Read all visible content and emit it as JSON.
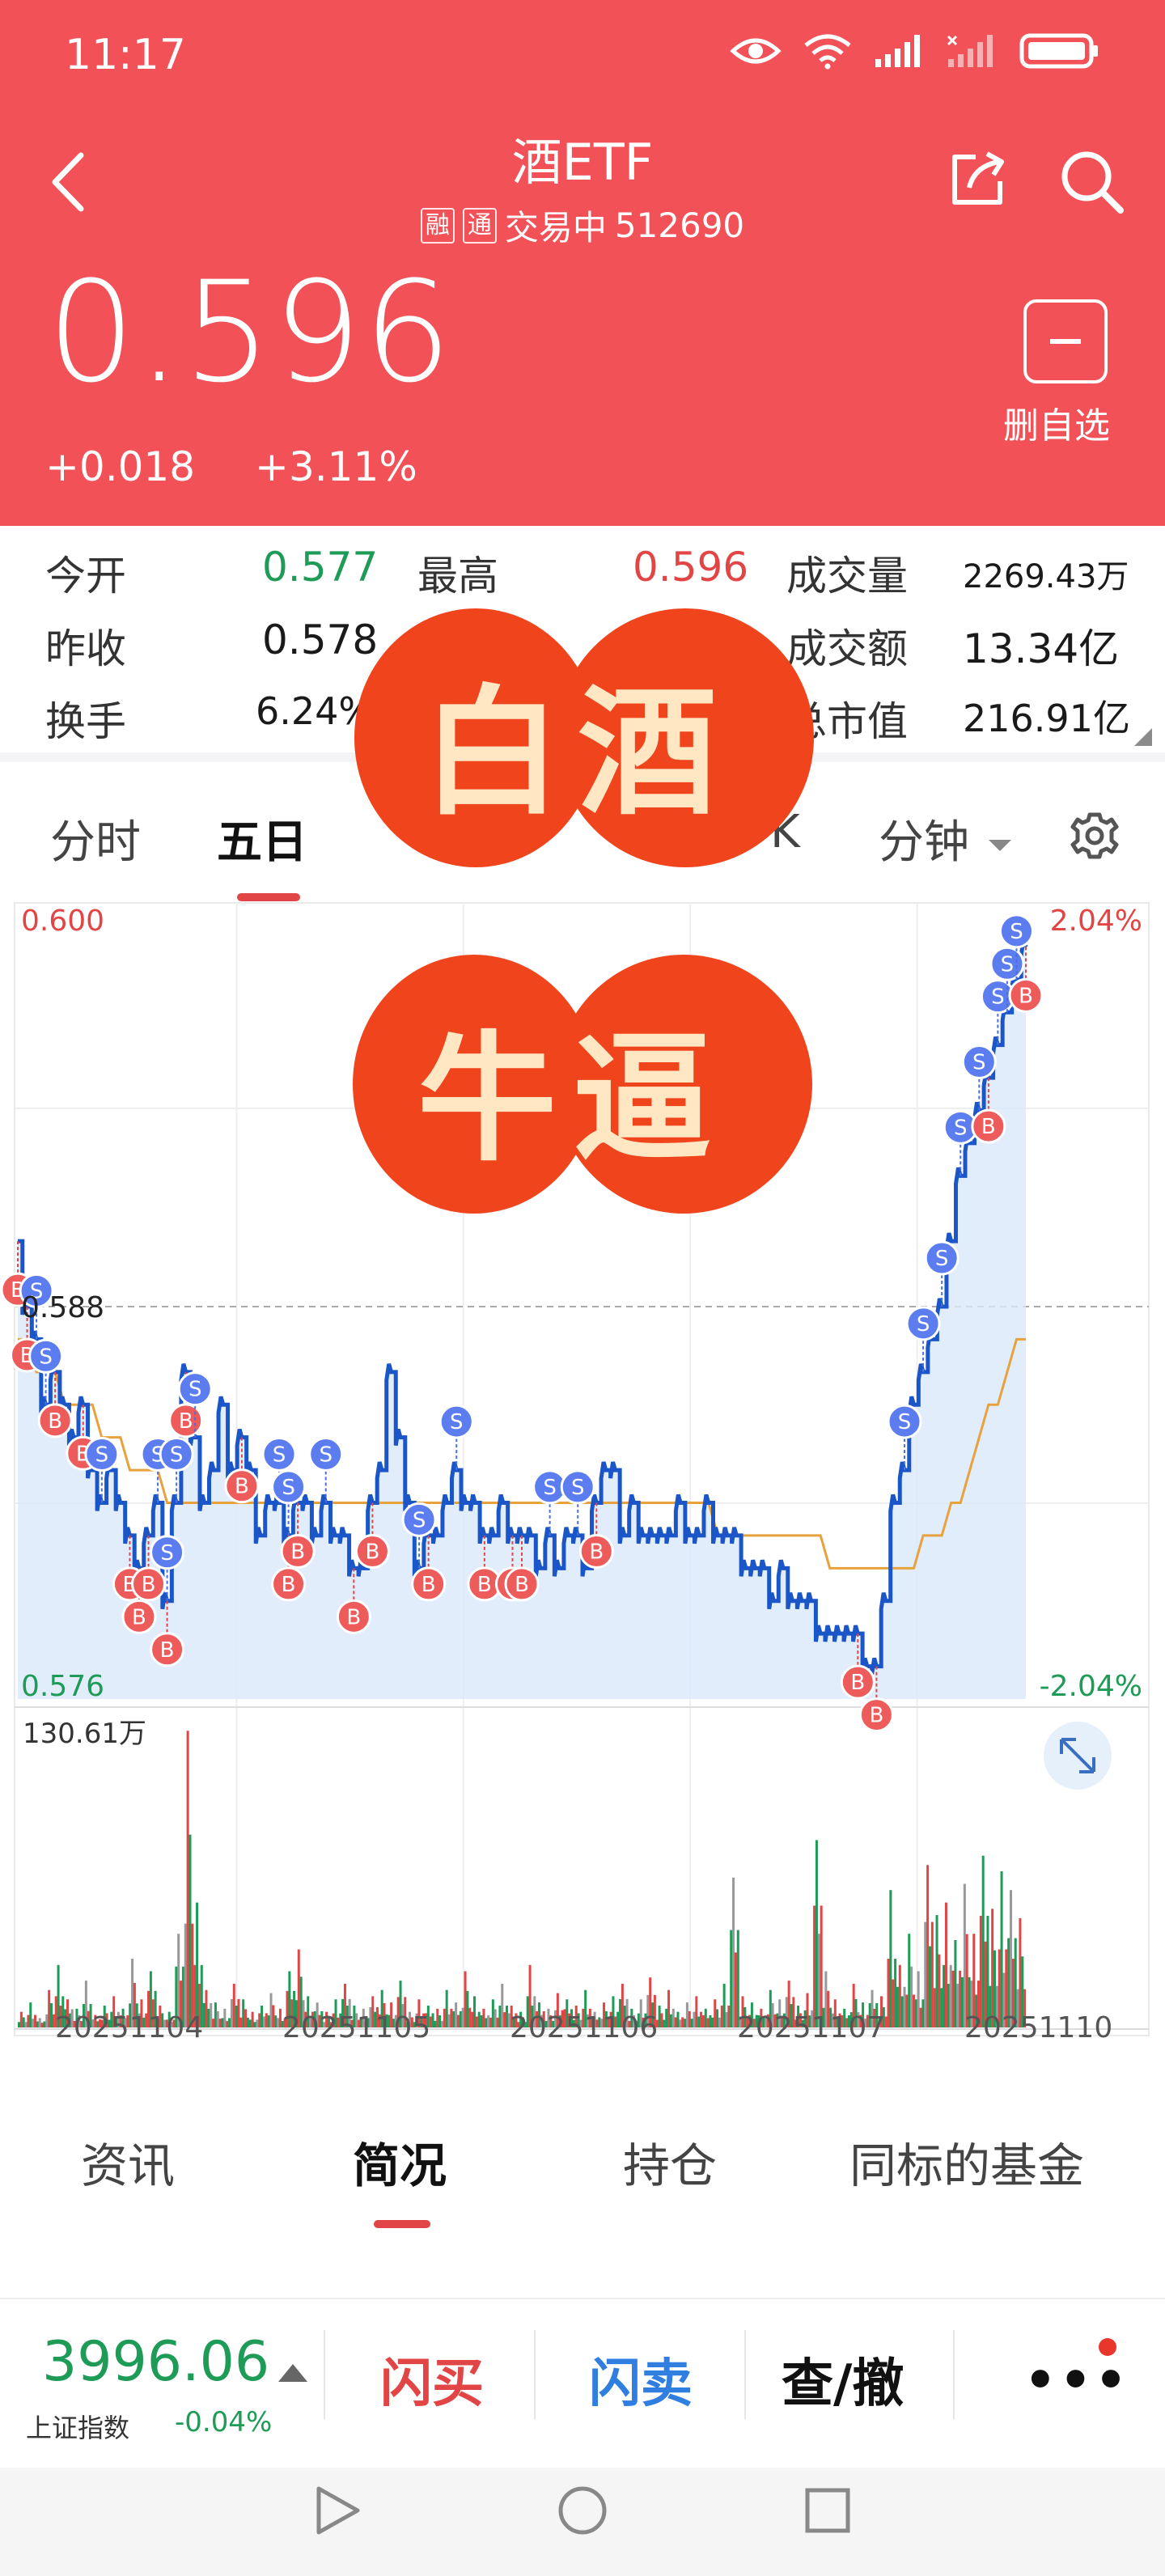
{
  "status": {
    "time": "11:17"
  },
  "header": {
    "title": "酒ETF",
    "tag1": "融",
    "tag2": "通",
    "trading_status": "交易中",
    "code": "512690",
    "price": "0.596",
    "change": "+0.018",
    "change_pct": "+3.11%",
    "remove_watch_label": "删自选",
    "bg_color": "#f25157"
  },
  "stats": {
    "open_label": "今开",
    "open_value": "0.577",
    "high_label": "最高",
    "high_value": "0.596",
    "volume_label": "成交量",
    "volume_value": "2269.43万",
    "prev_close_label": "昨收",
    "prev_close_value": "0.578",
    "amount_label": "成交额",
    "amount_value": "13.34亿",
    "turnover_label": "换手",
    "turnover_value": "6.24%",
    "mktcap_label": "总市值",
    "mktcap_value": "216.91亿"
  },
  "chart_tabs": {
    "intraday": "分时",
    "five_day": "五日",
    "k_partial": "K",
    "minute": "分钟"
  },
  "overlay": {
    "text1": "白酒",
    "text2": "牛逼"
  },
  "chart_data": {
    "type": "line",
    "price_axis": {
      "top": "0.600",
      "mid": "0.588",
      "bottom": "0.576"
    },
    "pct_axis": {
      "top": "2.04%",
      "bottom": "-2.04%"
    },
    "volume_max_label": "130.61万",
    "dates": [
      "20251104",
      "20251105",
      "20251106",
      "20251107",
      "20251110"
    ],
    "ylim": [
      0.576,
      0.6
    ],
    "reference": 0.588,
    "price_series": [
      0.59,
      0.588,
      0.587,
      0.585,
      0.586,
      0.585,
      0.584,
      0.585,
      0.583,
      0.582,
      0.583,
      0.582,
      0.581,
      0.58,
      0.581,
      0.582,
      0.579,
      0.582,
      0.586,
      0.584,
      0.582,
      0.583,
      0.585,
      0.583,
      0.584,
      0.583,
      0.581,
      0.582,
      0.582,
      0.581,
      0.582,
      0.582,
      0.581,
      0.582,
      0.581,
      0.581,
      0.58,
      0.58,
      0.582,
      0.583,
      0.586,
      0.584,
      0.582,
      0.58,
      0.581,
      0.581,
      0.582,
      0.583,
      0.582,
      0.582,
      0.581,
      0.581,
      0.582,
      0.581,
      0.581,
      0.581,
      0.58,
      0.581,
      0.58,
      0.581,
      0.581,
      0.58,
      0.582,
      0.583,
      0.583,
      0.581,
      0.582,
      0.581,
      0.581,
      0.581,
      0.581,
      0.582,
      0.581,
      0.581,
      0.582,
      0.581,
      0.581,
      0.581,
      0.58,
      0.58,
      0.58,
      0.579,
      0.58,
      0.579,
      0.579,
      0.579,
      0.578,
      0.578,
      0.578,
      0.578,
      0.578,
      0.577,
      0.577,
      0.579,
      0.582,
      0.583,
      0.585,
      0.586,
      0.587,
      0.588,
      0.59,
      0.592,
      0.593,
      0.594,
      0.595,
      0.596,
      0.597,
      0.598,
      0.599
    ],
    "avg_series": [
      0.587,
      0.587,
      0.586,
      0.586,
      0.586,
      0.585,
      0.585,
      0.585,
      0.585,
      0.584,
      0.584,
      0.584,
      0.583,
      0.583,
      0.583,
      0.583,
      0.582,
      0.582,
      0.582,
      0.582,
      0.582,
      0.582,
      0.582,
      0.582,
      0.582,
      0.582,
      0.582,
      0.582,
      0.582,
      0.582,
      0.582,
      0.582,
      0.582,
      0.582,
      0.582,
      0.582,
      0.582,
      0.582,
      0.582,
      0.582,
      0.582,
      0.582,
      0.582,
      0.582,
      0.582,
      0.582,
      0.582,
      0.582,
      0.582,
      0.582,
      0.582,
      0.582,
      0.582,
      0.582,
      0.582,
      0.582,
      0.582,
      0.582,
      0.582,
      0.582,
      0.582,
      0.582,
      0.582,
      0.582,
      0.582,
      0.582,
      0.582,
      0.582,
      0.582,
      0.582,
      0.582,
      0.582,
      0.582,
      0.582,
      0.582,
      0.581,
      0.581,
      0.581,
      0.581,
      0.581,
      0.581,
      0.581,
      0.581,
      0.581,
      0.581,
      0.581,
      0.581,
      0.58,
      0.58,
      0.58,
      0.58,
      0.58,
      0.58,
      0.58,
      0.58,
      0.58,
      0.58,
      0.581,
      0.581,
      0.581,
      0.582,
      0.582,
      0.583,
      0.584,
      0.585,
      0.585,
      0.586,
      0.587,
      0.587
    ],
    "markers": [
      {
        "t": "B",
        "i": 0
      },
      {
        "t": "B",
        "i": 1
      },
      {
        "t": "S",
        "i": 2
      },
      {
        "t": "S",
        "i": 3
      },
      {
        "t": "B",
        "i": 4
      },
      {
        "t": "B",
        "i": 7
      },
      {
        "t": "S",
        "i": 9
      },
      {
        "t": "B",
        "i": 12
      },
      {
        "t": "B",
        "i": 13
      },
      {
        "t": "B",
        "i": 14
      },
      {
        "t": "S",
        "i": 15
      },
      {
        "t": "S",
        "i": 16
      },
      {
        "t": "B",
        "i": 16
      },
      {
        "t": "S",
        "i": 17
      },
      {
        "t": "B",
        "i": 18
      },
      {
        "t": "S",
        "i": 19
      },
      {
        "t": "B",
        "i": 24
      },
      {
        "t": "S",
        "i": 28
      },
      {
        "t": "S",
        "i": 29
      },
      {
        "t": "B",
        "i": 29
      },
      {
        "t": "B",
        "i": 30
      },
      {
        "t": "S",
        "i": 33
      },
      {
        "t": "B",
        "i": 36
      },
      {
        "t": "B",
        "i": 38
      },
      {
        "t": "S",
        "i": 43
      },
      {
        "t": "B",
        "i": 44
      },
      {
        "t": "S",
        "i": 47
      },
      {
        "t": "B",
        "i": 50
      },
      {
        "t": "B",
        "i": 53
      },
      {
        "t": "B",
        "i": 54
      },
      {
        "t": "S",
        "i": 57
      },
      {
        "t": "S",
        "i": 60
      },
      {
        "t": "B",
        "i": 62
      },
      {
        "t": "B",
        "i": 90
      },
      {
        "t": "B",
        "i": 92
      },
      {
        "t": "S",
        "i": 95
      },
      {
        "t": "S",
        "i": 97
      },
      {
        "t": "S",
        "i": 99
      },
      {
        "t": "S",
        "i": 101
      },
      {
        "t": "S",
        "i": 103
      },
      {
        "t": "B",
        "i": 104
      },
      {
        "t": "S",
        "i": 105
      },
      {
        "t": "S",
        "i": 106
      },
      {
        "t": "S",
        "i": 107
      },
      {
        "t": "B",
        "i": 108
      }
    ],
    "volume": [
      5,
      8,
      3,
      12,
      20,
      9,
      6,
      15,
      4,
      7,
      10,
      6,
      22,
      9,
      18,
      7,
      5,
      30,
      95,
      40,
      12,
      8,
      6,
      14,
      9,
      5,
      7,
      11,
      6,
      18,
      25,
      10,
      8,
      5,
      9,
      14,
      7,
      6,
      10,
      12,
      8,
      15,
      5,
      9,
      7,
      6,
      12,
      8,
      18,
      10,
      6,
      9,
      14,
      7,
      5,
      20,
      8,
      6,
      11,
      9,
      7,
      12,
      5,
      8,
      10,
      14,
      6,
      9,
      16,
      7,
      12,
      5,
      8,
      10,
      6,
      9,
      14,
      48,
      10,
      8,
      6,
      12,
      9,
      15,
      7,
      11,
      60,
      18,
      9,
      6,
      14,
      8,
      12,
      10,
      44,
      20,
      30,
      18,
      52,
      36,
      40,
      28,
      46,
      30,
      55,
      38,
      50,
      44,
      35
    ]
  },
  "bottom_tabs": {
    "news": "资讯",
    "overview": "简况",
    "holdings": "持仓",
    "same_index": "同标的基金"
  },
  "index": {
    "value": "3996.06",
    "name": "上证指数",
    "change": "-0.04%"
  },
  "actions": {
    "flash_buy": "闪买",
    "flash_sell": "闪卖",
    "query_cancel": "查/撤"
  }
}
